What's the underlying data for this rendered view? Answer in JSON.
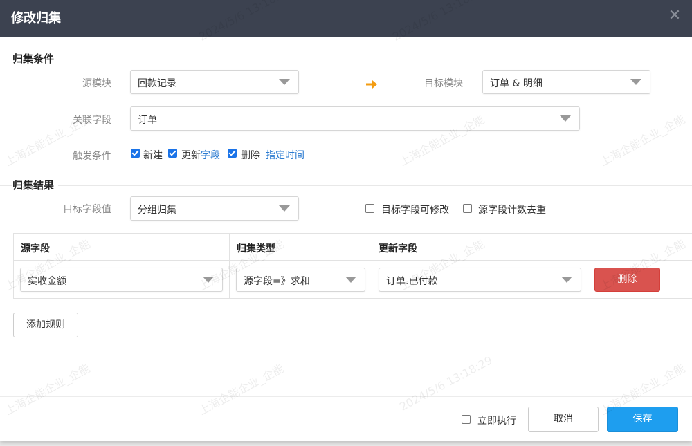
{
  "dialog": {
    "title": "修改归集",
    "close_glyph": "✕"
  },
  "conditions": {
    "section_title": "归集条件",
    "source_module_label": "源模块",
    "source_module_value": "回款记录",
    "target_module_label": "目标模块",
    "target_module_value": "订单 & 明细",
    "relation_field_label": "关联字段",
    "relation_field_value": "订单",
    "trigger_label": "触发条件",
    "trigger_options": [
      {
        "label": "新建",
        "checked": true
      },
      {
        "label_prefix": "更新",
        "label_link": "字段",
        "checked": true
      },
      {
        "label": "删除",
        "checked": true
      }
    ],
    "schedule_link": "指定时间"
  },
  "result": {
    "section_title": "归集结果",
    "target_value_label": "目标字段值",
    "target_value_value": "分组归集",
    "option_target_editable": {
      "label": "目标字段可修改",
      "checked": false
    },
    "option_source_dedupe": {
      "label": "源字段计数去重",
      "checked": false
    }
  },
  "table": {
    "headers": [
      "源字段",
      "归集类型",
      "更新字段",
      ""
    ],
    "rows": [
      {
        "source_field": "实收金额",
        "agg_type": "源字段=》求和",
        "update_field": "订单.已付款",
        "delete_label": "删除"
      }
    ],
    "add_rule_label": "添加规则"
  },
  "footer": {
    "run_now": {
      "label": "立即执行",
      "checked": false
    },
    "cancel_label": "取消",
    "save_label": "保存"
  },
  "watermark": {
    "text": "上海企能企业_企能",
    "timestamp": "2024/5/6 13:18:29"
  },
  "colors": {
    "header_bg": "#3c4250",
    "primary": "#1e9eef",
    "danger": "#d9534f",
    "arrow": "#f39c12",
    "link": "#2b7bd1"
  }
}
